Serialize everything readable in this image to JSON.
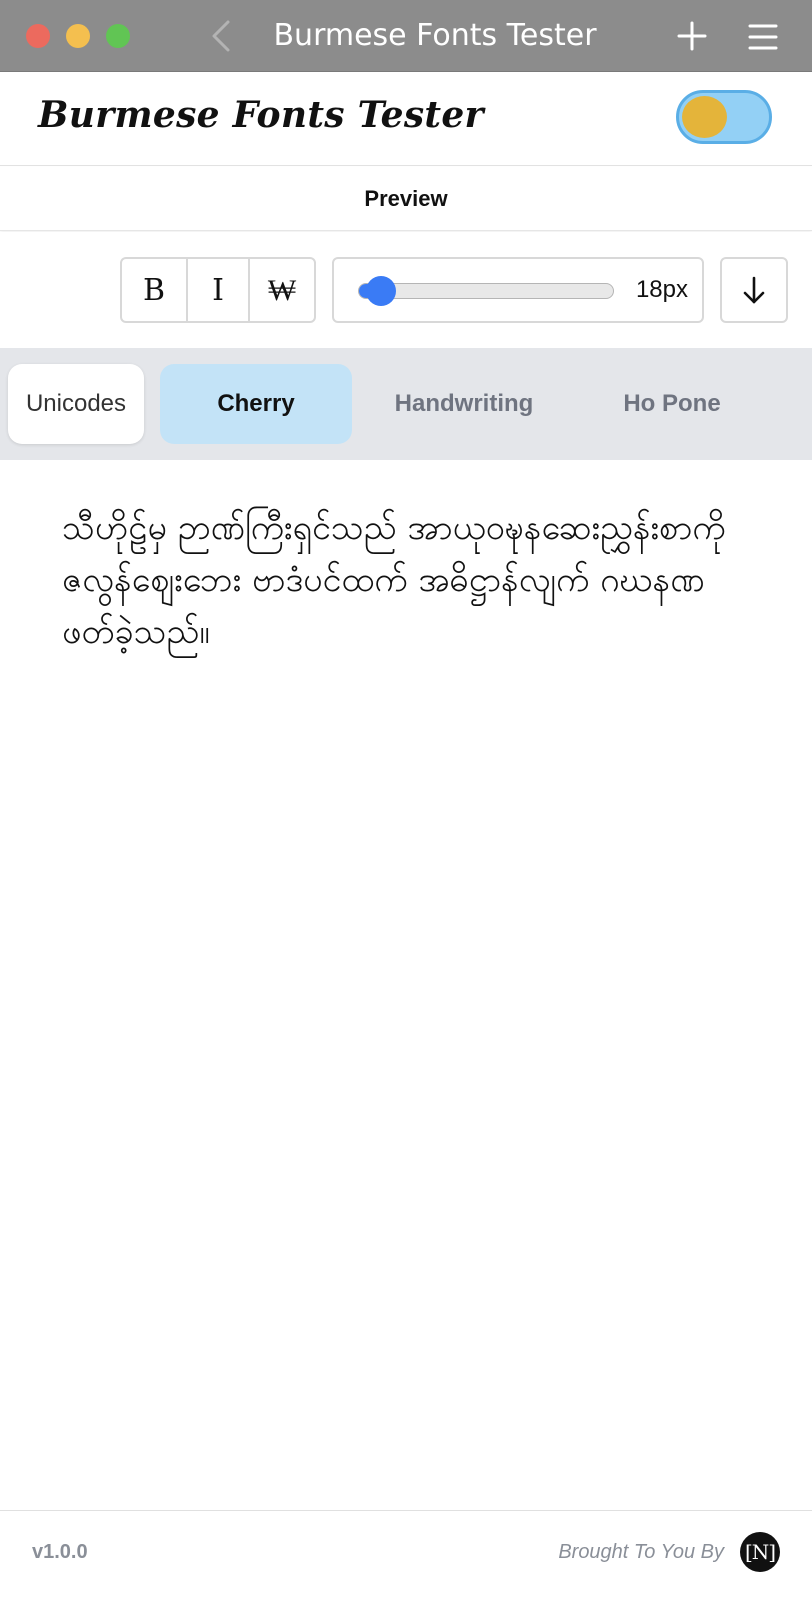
{
  "window": {
    "title": "Burmese Fonts Tester",
    "icons": [
      "back-chevron-icon",
      "plus-icon",
      "hamburger-menu-icon"
    ]
  },
  "header": {
    "brand": "Burmese Fonts Tester",
    "theme_toggle": {
      "state": "on",
      "knob_color": "#e4b43a",
      "track_color": "#93d0f5"
    }
  },
  "preview_section": {
    "label": "Preview"
  },
  "toolbar": {
    "bold_label": "B",
    "italic_label": "I",
    "strike_label": "₩",
    "font_size": {
      "value_label": "18px",
      "level": 0.05
    },
    "download_icon": "arrow-down-icon"
  },
  "font_tabs": [
    {
      "label": "Unicodes",
      "selected": false
    },
    {
      "label": "Cherry",
      "selected": true
    },
    {
      "label": "Handwriting",
      "selected": false
    },
    {
      "label": "Ho Pone",
      "selected": false
    }
  ],
  "preview_text": "သီဟိုဠ်မှ ဉာဏ်ကြီးရှင်သည် အာယုဝဍ္ဎနဆေးညွှန်းစာကို ဇလွန်ဈေးဘေး ဗာဒံပင်ထက် အဓိဋ္ဌာန်လျက် ဂဃနဏဖတ်ခဲ့သည်။",
  "footer": {
    "version": "v1.0.0",
    "credit": "Brought To You By",
    "logo_text": "[N]"
  },
  "colors": {
    "accent": "#3a7bf5",
    "selected_tab": "#c3e3f7",
    "titlebar": "#8c8c8c"
  }
}
